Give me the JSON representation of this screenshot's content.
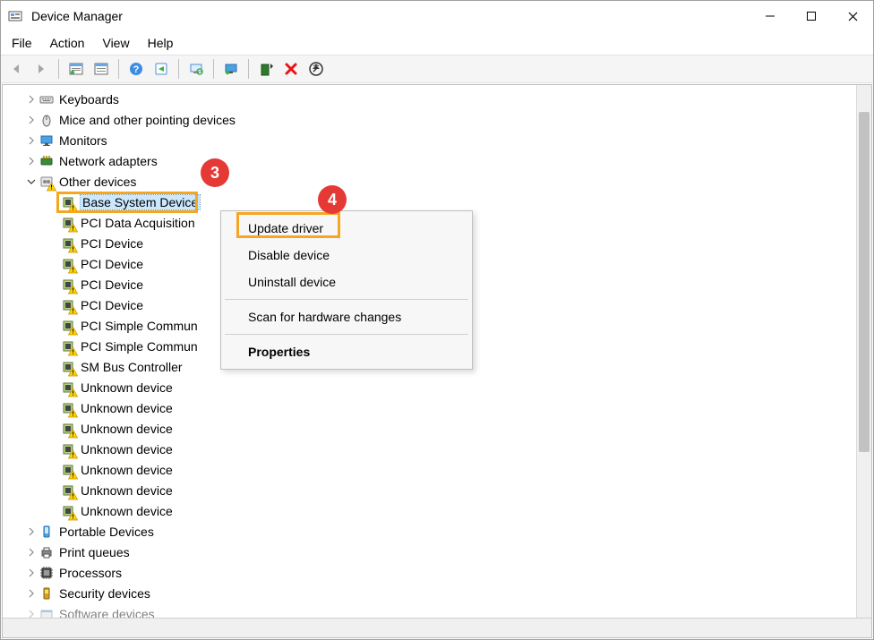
{
  "window": {
    "title": "Device Manager"
  },
  "menubar": {
    "file": "File",
    "action": "Action",
    "view": "View",
    "help": "Help"
  },
  "tree": {
    "keyboards": "Keyboards",
    "mice": "Mice and other pointing devices",
    "monitors": "Monitors",
    "network_adapters": "Network adapters",
    "other_devices": "Other devices",
    "portable_devices": "Portable Devices",
    "print_queues": "Print queues",
    "processors": "Processors",
    "security_devices": "Security devices",
    "software_devices": "Software devices",
    "children": {
      "base_system_device": "Base System Device",
      "pci_data_acquisition": "PCI Data Acquisition",
      "pci_device_1": "PCI Device",
      "pci_device_2": "PCI Device",
      "pci_device_3": "PCI Device",
      "pci_device_4": "PCI Device",
      "pci_simple_comm_1": "PCI Simple Commun",
      "pci_simple_comm_2": "PCI Simple Commun",
      "sm_bus_controller": "SM Bus Controller",
      "unknown_device_1": "Unknown device",
      "unknown_device_2": "Unknown device",
      "unknown_device_3": "Unknown device",
      "unknown_device_4": "Unknown device",
      "unknown_device_5": "Unknown device",
      "unknown_device_6": "Unknown device",
      "unknown_device_7": "Unknown device"
    }
  },
  "context_menu": {
    "update_driver": "Update driver",
    "disable_device": "Disable device",
    "uninstall_device": "Uninstall device",
    "scan_hardware": "Scan for hardware changes",
    "properties": "Properties"
  },
  "callouts": {
    "three": "3",
    "four": "4"
  }
}
